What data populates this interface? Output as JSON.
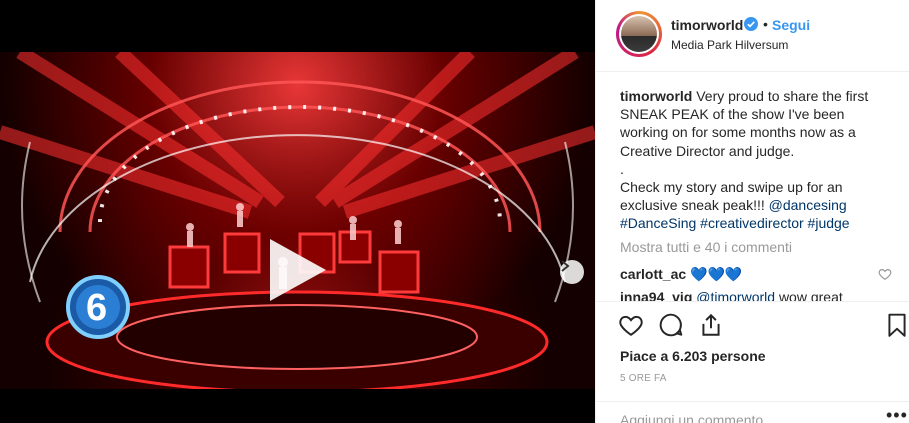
{
  "post": {
    "username": "timorworld",
    "separator": "•",
    "follow_label": "Segui",
    "location": "Media Park Hilversum",
    "caption": {
      "username": "timorworld",
      "line1": "Very proud to share the first SNEAK PEAK of the show I've been working on for some months now as a Creative Director and judge.",
      "line2": ".",
      "line3": "Check my story and swipe up for an exclusive sneak peak!!! ",
      "mention": "@dancesing",
      "hashtags": "#DanceSing #creativedirector #judge"
    },
    "view_all_comments": "Mostra tutti e 40 i commenti",
    "comments": [
      {
        "username": "carlott_ac",
        "text": "💙💙💙"
      },
      {
        "username": "inna94_vig",
        "mention": "@timorworld",
        "text": "wow great"
      }
    ],
    "likes_text": "Piace a 6.203 persone",
    "timestamp": "5 ORE FA",
    "comment_placeholder": "Aggiungi un commento...",
    "more_label": "•••"
  },
  "media": {
    "carousel_total": 2,
    "carousel_index": 1,
    "overlay_logo_text": "6"
  },
  "colors": {
    "link_blue": "#3897f0",
    "hashtag": "#003569",
    "muted": "#999999",
    "heart_blue": "#1da1f2"
  },
  "icons": [
    "verified-icon",
    "play-icon",
    "chevron-right-icon",
    "heart-icon",
    "comment-icon",
    "share-icon",
    "bookmark-icon",
    "heart-small-icon"
  ]
}
